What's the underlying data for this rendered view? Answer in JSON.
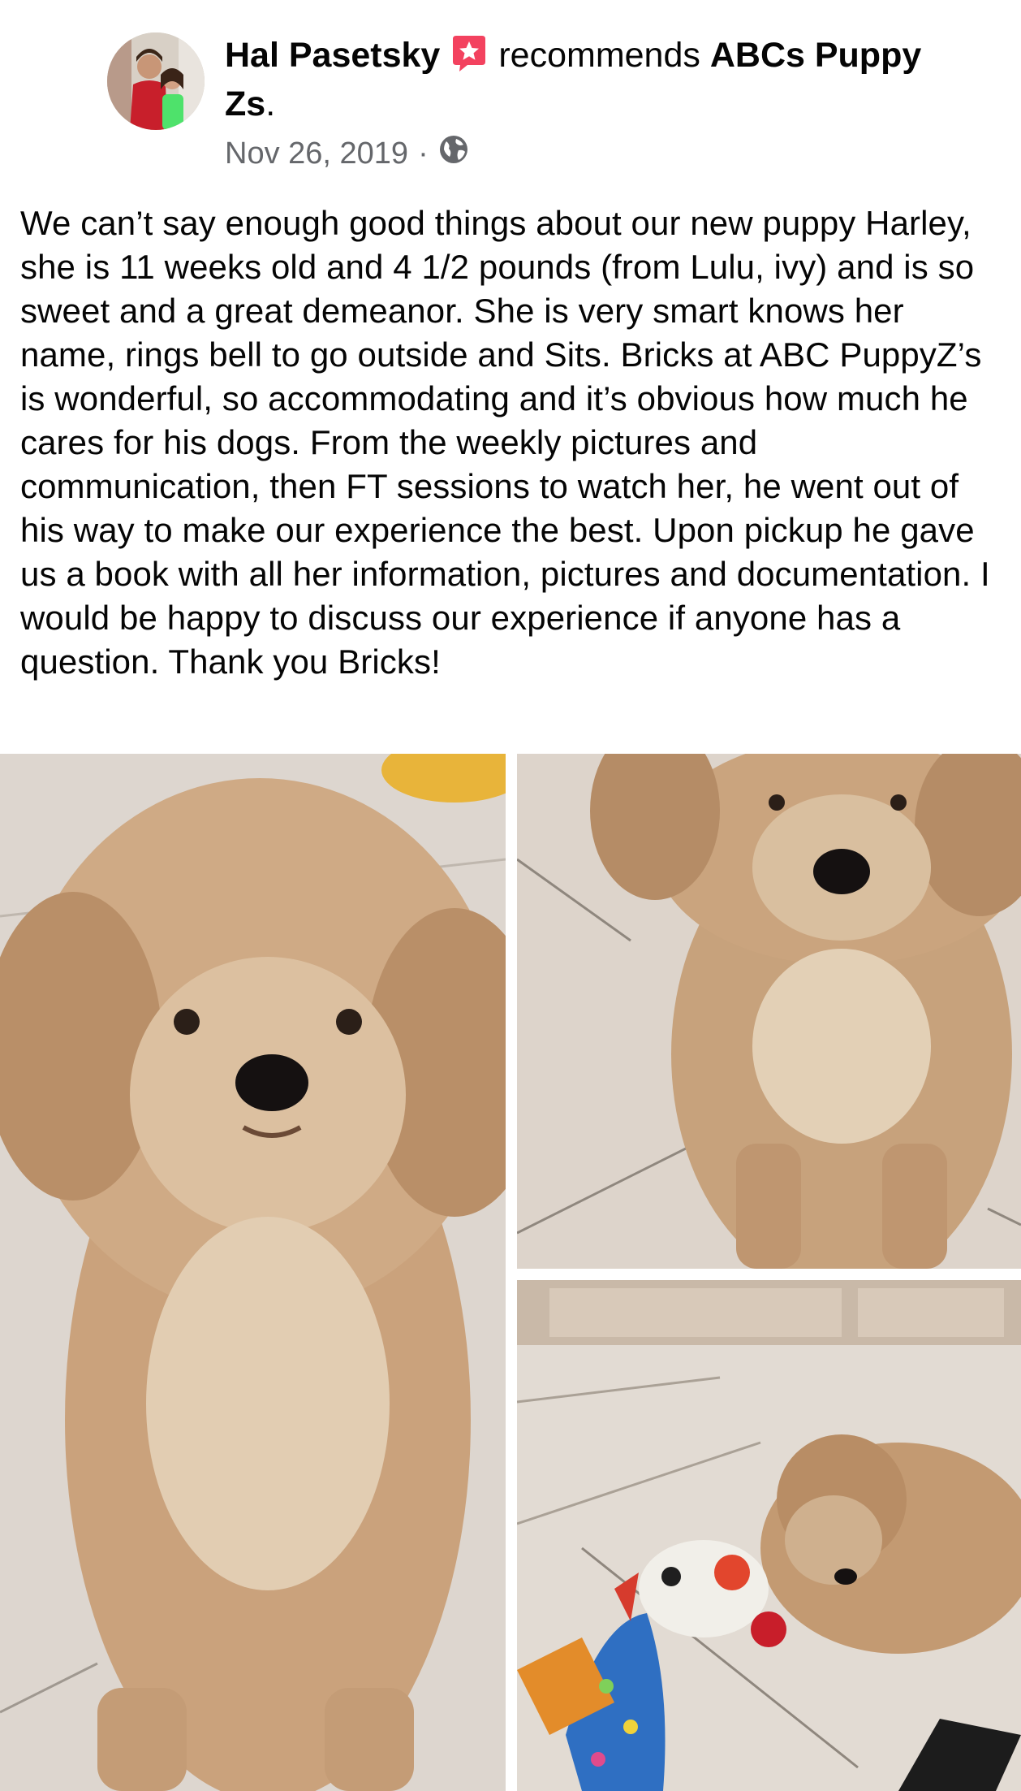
{
  "post": {
    "author": "Hal Pasetsky",
    "action": "recommends",
    "page_name": "ABCs Puppy Zs",
    "period": ".",
    "date": "Nov 26, 2019",
    "separator": "·",
    "privacy_icon": "globe-icon",
    "recommend_icon": "recommend-star-icon",
    "body": "We can’t say enough good things about our new puppy Harley, she is 11 weeks old and 4 1/2 pounds (from Lulu, ivy) and is so sweet and a great demeanor. She is very smart knows her name, rings bell to go outside and Sits. Bricks at ABC PuppyZ’s is wonderful, so accommodating and it’s obvious how much he cares for his dogs. From the weekly pictures and communication, then FT sessions to watch her, he went out of his way to make our experience the best. Upon pickup he gave us a book with all her information, pictures and documentation. I would be happy to discuss our experience if anyone has a question. Thank you Bricks!"
  },
  "colors": {
    "recommend_badge": "#f3425f",
    "meta_text": "#65676b",
    "text": "#050505"
  }
}
